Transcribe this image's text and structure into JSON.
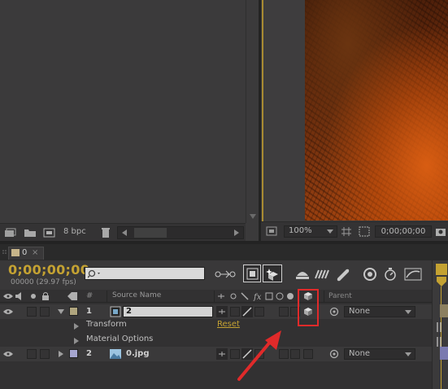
{
  "project_panel": {
    "bpc_label": "8 bpc"
  },
  "comp_panel": {
    "zoom": "100%",
    "timecode": "0;00;00;00"
  },
  "timeline": {
    "tab_label": "0",
    "current_time": "0;00;00;00",
    "frame_info": "00000 (29.97 fps)",
    "search_placeholder": "",
    "columns": {
      "index": "#",
      "source_name": "Source Name",
      "parent": "Parent"
    },
    "layers": [
      {
        "index": "1",
        "name": "2",
        "parent": "None",
        "label_color": "#b0a57e"
      },
      {
        "index": "2",
        "name": "0.jpg",
        "parent": "None",
        "label_color": "#a6a6d0"
      }
    ],
    "properties": {
      "transform": "Transform",
      "transform_reset": "Reset",
      "material_options": "Material Options"
    }
  },
  "colors": {
    "accent_gold": "#c4a232",
    "highlight_red": "#e02a2a"
  }
}
